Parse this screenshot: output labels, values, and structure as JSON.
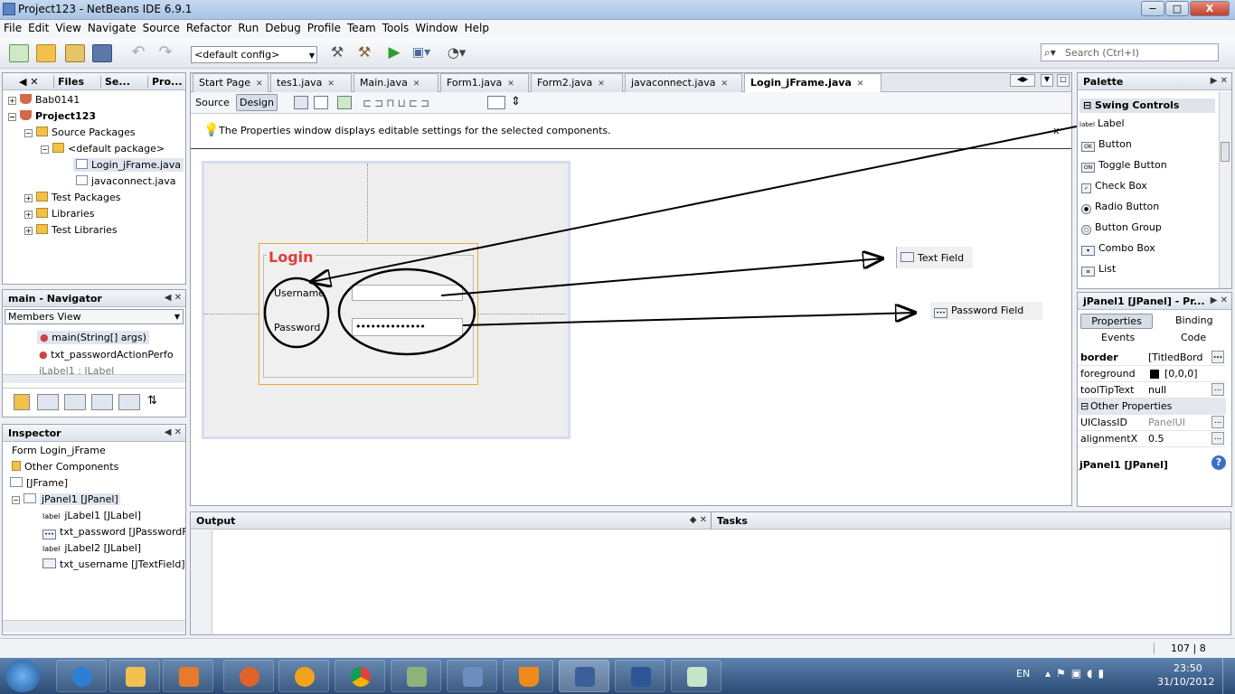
{
  "window": {
    "title": "Project123 - NetBeans IDE 6.9.1",
    "min": "−",
    "max": "□",
    "close": "X"
  },
  "menu": [
    "File",
    "Edit",
    "View",
    "Navigate",
    "Source",
    "Refactor",
    "Run",
    "Debug",
    "Profile",
    "Team",
    "Tools",
    "Window",
    "Help"
  ],
  "toolbar": {
    "config": "<default config>",
    "search_placeholder": "Search (Ctrl+I)"
  },
  "projects_tabs": [
    "Files",
    "Se...",
    "Pro..."
  ],
  "project_tree": {
    "bab": "Bab0141",
    "project": "Project123",
    "source_packages": "Source Packages",
    "default_package": "<default package>",
    "file_login": "Login_jFrame.java",
    "file_connect": "javaconnect.java",
    "test_packages": "Test Packages",
    "libraries": "Libraries",
    "test_libraries": "Test Libraries"
  },
  "navigator": {
    "title": "main - Navigator",
    "view": "Members View",
    "items": [
      "main(String[] args)",
      "txt_passwordActionPerfo",
      "jLabel1 : JLabel"
    ]
  },
  "inspector": {
    "title": "Inspector",
    "items": [
      "Form Login_jFrame",
      "Other Components",
      "[JFrame]",
      "jPanel1 [JPanel]",
      "jLabel1 [JLabel]",
      "txt_password [JPasswordFie",
      "jLabel2 [JLabel]",
      "txt_username [JTextField]"
    ]
  },
  "editor_tabs": [
    "Start Page",
    "tes1.java",
    "Main.java",
    "Form1.java",
    "Form2.java",
    "javaconnect.java",
    "Login_jFrame.java"
  ],
  "editor": {
    "source_btn": "Source",
    "design_btn": "Design",
    "hint": "The Properties window displays editable settings for the selected components.",
    "hint_close": "x"
  },
  "form": {
    "title": "Login",
    "username_label": "Username",
    "password_label": "Password",
    "password_value": "••••••••••••••"
  },
  "floating_palette": {
    "text_field": "Text Field",
    "password_field": "Password Field"
  },
  "palette": {
    "title": "Palette",
    "category": "Swing Controls",
    "items": [
      "Label",
      "Button",
      "Toggle Button",
      "Check Box",
      "Radio Button",
      "Button Group",
      "Combo Box",
      "List"
    ]
  },
  "properties": {
    "title": "jPanel1 [JPanel] - Pr...",
    "tabs": [
      "Properties",
      "Binding",
      "Events",
      "Code"
    ],
    "rows": [
      {
        "key": "border",
        "value": "[TitledBorde"
      },
      {
        "key": "foreground",
        "value": "[0,0,0]"
      },
      {
        "key": "toolTipText",
        "value": "null"
      }
    ],
    "other_header": "Other Properties",
    "other_rows": [
      {
        "key": "UIClassID",
        "value": "PanelUI"
      },
      {
        "key": "alignmentX",
        "value": "0.5"
      }
    ],
    "footer": "jPanel1 [JPanel]"
  },
  "output": {
    "title": "Output",
    "tasks": "Tasks"
  },
  "status": {
    "position": "107 | 8"
  },
  "taskbar": {
    "lang": "EN",
    "time": "23:50",
    "date": "31/10/2012"
  }
}
